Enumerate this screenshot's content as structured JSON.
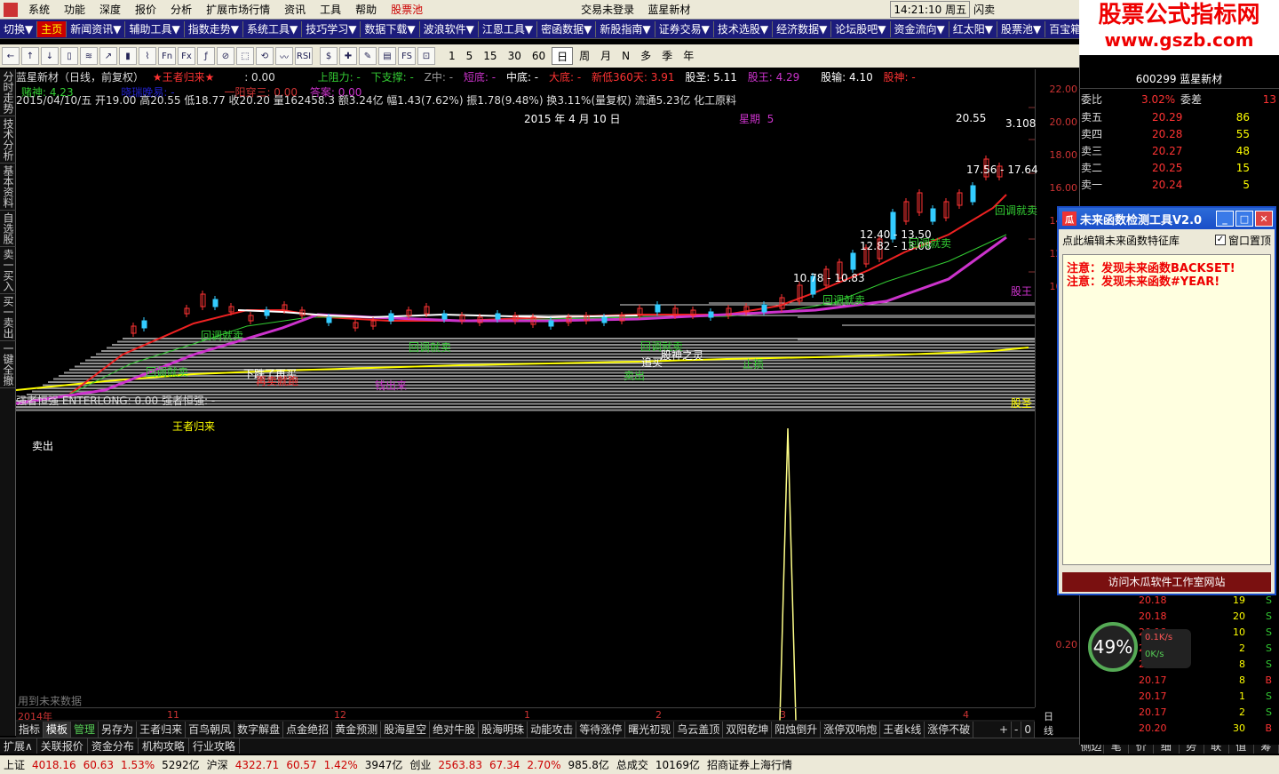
{
  "menu": [
    "系统",
    "功能",
    "深度",
    "报价",
    "分析",
    "扩展市场行情",
    "资讯",
    "工具",
    "帮助",
    "股票池"
  ],
  "title_center": "交易未登录    蓝星新材",
  "clock": "14:21:10 周五",
  "flash": "闪卖",
  "logo": {
    "line1": "股票公式指标网",
    "line2": "www.gszb.com"
  },
  "toolbar1": [
    "切换▼",
    "主页",
    "新闻资讯▼",
    "辅助工具▼",
    "指数走势▼",
    "系统工具▼",
    "技巧学习▼",
    "数据下载▼",
    "波浪软件▼",
    "江恩工具▼",
    "密函数据▼",
    "新股指南▼",
    "证券交易▼",
    "技术选股▼",
    "经济数据▼",
    "论坛股吧▼",
    "资金流向▼",
    "红太阳▼",
    "股票池▼",
    "百宝箱▼"
  ],
  "toolbar2_icons": [
    "←",
    "↑",
    "↓",
    "▯",
    "≋",
    "↗",
    "▮",
    "⌇",
    "Fn",
    "Fx",
    "ƒ",
    "⊘",
    "⬚",
    "⟲",
    "〰",
    "RSI",
    "$",
    "✚",
    "✎",
    "▤",
    "FS",
    "⊡"
  ],
  "periods": [
    "1",
    "5",
    "15",
    "30",
    "60",
    "日",
    "周",
    "月",
    "N",
    "多",
    "季",
    "年"
  ],
  "side_tabs": [
    "分时走势",
    "技术分析",
    "基本资料",
    "自选股",
    "卖一买入",
    "买一卖出",
    "一键全撤"
  ],
  "info1": {
    "name": "蓝星新材（日线，前复权）",
    "ind": "★王者归来★",
    "val": ": 0.00",
    "up": "上阻力: -",
    "down": "下支撑: -",
    "z": "Z中: -",
    "short": "短底: -",
    "mid": "中底: -",
    "big": "大底: -",
    "newlow": "新低360天: 3.91",
    "gusheng": "股圣: 5.11",
    "guwang": "股王: 4.29",
    "gushu": "股输: 4.10",
    "gushen": "股神: -"
  },
  "info1b": {
    "dushen": "赌神: 4.23",
    "hidden": "晓瑞晚易: -",
    "yiyang": "一阳穿三: 0.00",
    "daan": "答案: 0.00"
  },
  "info2": "2015/04/10/五 开19.00 高20.55 低18.77 收20.20 量162458.3 额3.24亿 幅1.43(7.62%) 振1.78(9.48%) 换3.11%(量复权) 流通5.23亿 化工原料",
  "date_label": "2015 年 4 月 10 日",
  "weekday_label": "星期  5",
  "price_labels": {
    "high": "20.55",
    "p3108": "3.108",
    "l1756": "17.56 - 17.64",
    "l1240": "12.40 - 13.50",
    "l1282": "12.82 - 13.08",
    "l1078": "10.78 - 10.83"
  },
  "chart_annotations": [
    "回调就卖",
    "回调就卖",
    "回调就卖",
    "回调就卖",
    "回调就卖",
    "回调就卖",
    "回调就卖",
    "王者归来",
    "股王",
    "股圣",
    "下跌了再买",
    "再卖就跑",
    "钱出来",
    "卖出",
    "止损",
    "追买",
    "股神之灵",
    "卖出"
  ],
  "yaxis": [
    "22.00",
    "20.00",
    "18.00",
    "16.00",
    "14.00",
    "12.00",
    "10.00"
  ],
  "yaxis_sub": "0.20",
  "sub_info": "强者恒强 ENTERLONG: 0.00 强者恒强: -",
  "sub_note": "用到未来数据",
  "dates": [
    "2014年",
    "11",
    "12",
    "1",
    "2",
    "3",
    "4"
  ],
  "date_axis_label": "日线",
  "bottom_tabs": [
    "指标",
    "模板",
    "管理",
    "另存为",
    "王者归来",
    "百鸟朝凤",
    "数字解盘",
    "点金绝招",
    "黄金预测",
    "股海星空",
    "绝对牛股",
    "股海明珠",
    "动能攻击",
    "等待涨停",
    "曙光初现",
    "乌云盖顶",
    "双阳乾坤",
    "阳烛倒升",
    "涨停双响炮",
    "王者k线",
    "涨停不破"
  ],
  "bottom_tabs_right": [
    "+",
    "-",
    "0"
  ],
  "tabs2": [
    "扩展∧",
    "关联报价",
    "资金分布",
    "机构攻略",
    "行业攻略"
  ],
  "rtabs": [
    "侧边栏<",
    "笔",
    "价",
    "细",
    "势",
    "联",
    "值",
    "筹"
  ],
  "quote": {
    "code": "600299 蓝星新材",
    "webi_label": "委比",
    "webi": "3.02%",
    "wecha_label": "委差",
    "wecha": "13",
    "asks": [
      {
        "n": "卖五",
        "p": "20.29",
        "v": "86"
      },
      {
        "n": "卖四",
        "p": "20.28",
        "v": "55"
      },
      {
        "n": "卖三",
        "p": "20.27",
        "v": "48"
      },
      {
        "n": "卖二",
        "p": "20.25",
        "v": "15"
      },
      {
        "n": "卖一",
        "p": "20.24",
        "v": "5"
      }
    ]
  },
  "ticks": [
    {
      "p": "20.18",
      "v": "19",
      "t": "S"
    },
    {
      "p": "20.18",
      "v": "20",
      "t": "S"
    },
    {
      "p": "20.18",
      "v": "10",
      "t": "S"
    },
    {
      "p": "20.17",
      "v": "2",
      "t": "S"
    },
    {
      "p": "20.16",
      "v": "8",
      "t": "S"
    },
    {
      "p": "20.17",
      "v": "8",
      "t": "B"
    },
    {
      "p": "20.17",
      "v": "1",
      "t": "S"
    },
    {
      "p": "20.17",
      "v": "2",
      "t": "S"
    },
    {
      "p": "20.20",
      "v": "30",
      "t": "B"
    }
  ],
  "gauge": "49%",
  "net": {
    "up": "0.1K/s",
    "down": "0K/s"
  },
  "dialog": {
    "title": "未来函数检测工具V2.0",
    "bar": "点此编辑未来函数特征库",
    "ontop": "窗口置顶",
    "lines": [
      "注意：发现未来函数BACKSET!",
      "注意：发现未来函数#YEAR!"
    ],
    "footer": "访问木瓜软件工作室网站"
  },
  "status": {
    "sh": "上证",
    "sh_v": "4018.16",
    "sh_c": "60.63",
    "sh_p": "1.53%",
    "sh_a": "5292亿",
    "hs": "沪深",
    "hs_v": "4322.71",
    "hs_c": "60.57",
    "hs_p": "1.42%",
    "hs_a": "3947亿",
    "cy": "创业",
    "cy_v": "2563.83",
    "cy_c": "67.34",
    "cy_p": "2.70%",
    "cy_a": "985.8亿",
    "total_l": "总成交",
    "total": "10169亿",
    "broker": "招商证券上海行情"
  }
}
